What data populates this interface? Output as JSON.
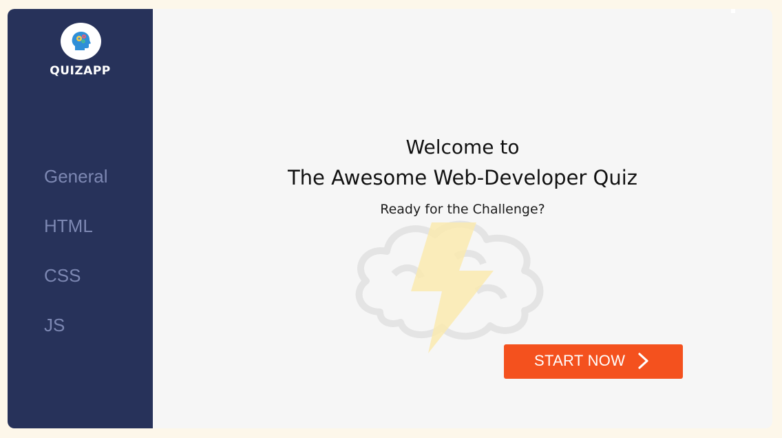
{
  "sidebar": {
    "brand": "QUIZAPP",
    "logo_icon": "brain-gears-icon",
    "items": [
      {
        "label": "General"
      },
      {
        "label": "HTML"
      },
      {
        "label": "CSS"
      },
      {
        "label": "JS"
      }
    ]
  },
  "main": {
    "welcome_line1": "Welcome to",
    "welcome_line2": "The Awesome Web-Developer Quiz",
    "subtitle": "Ready for the Challenge?",
    "start_button": "START NOW",
    "illustration_icon": "brain-lightning-icon"
  },
  "colors": {
    "sidebar_bg": "#27325a",
    "nav_text": "#7d88b3",
    "accent": "#f4511e",
    "page_bg": "#fdf7ea"
  }
}
